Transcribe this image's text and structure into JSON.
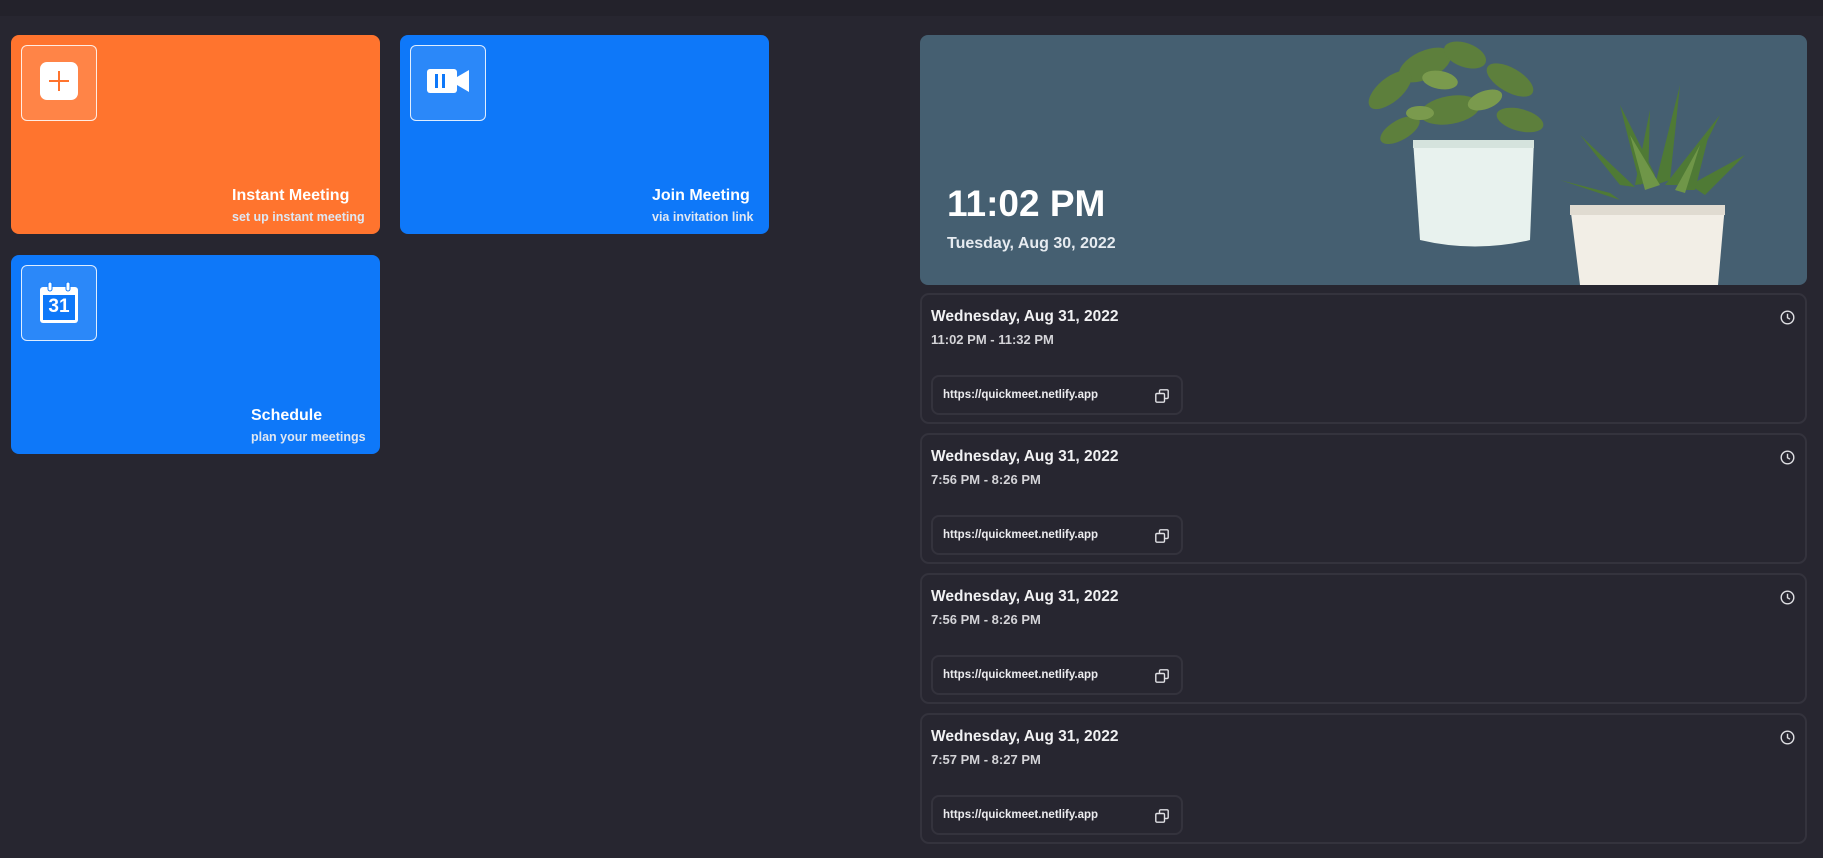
{
  "actions": {
    "instant": {
      "title": "Instant Meeting",
      "subtitle": "set up instant meeting",
      "icon": "plus-icon",
      "color": "#ff742e"
    },
    "join": {
      "title": "Join Meeting",
      "subtitle": "via invitation link",
      "icon": "video-camera-icon",
      "color": "#0e78f9"
    },
    "schedule": {
      "title": "Schedule",
      "subtitle": "plan your meetings",
      "icon": "calendar-icon",
      "day": "31",
      "color": "#0e78f9"
    }
  },
  "hero": {
    "time": "11:02 PM",
    "date": "Tuesday, Aug 30, 2022",
    "background": "#455f71"
  },
  "meetings": [
    {
      "date": "Wednesday, Aug 31, 2022",
      "time": "11:02 PM - 11:32 PM",
      "link": "https://quickmeet.netlify.app"
    },
    {
      "date": "Wednesday, Aug 31, 2022",
      "time": "7:56 PM - 8:26 PM",
      "link": "https://quickmeet.netlify.app"
    },
    {
      "date": "Wednesday, Aug 31, 2022",
      "time": "7:56 PM - 8:26 PM",
      "link": "https://quickmeet.netlify.app"
    },
    {
      "date": "Wednesday, Aug 31, 2022",
      "time": "7:57 PM - 8:27 PM",
      "link": "https://quickmeet.netlify.app"
    }
  ]
}
